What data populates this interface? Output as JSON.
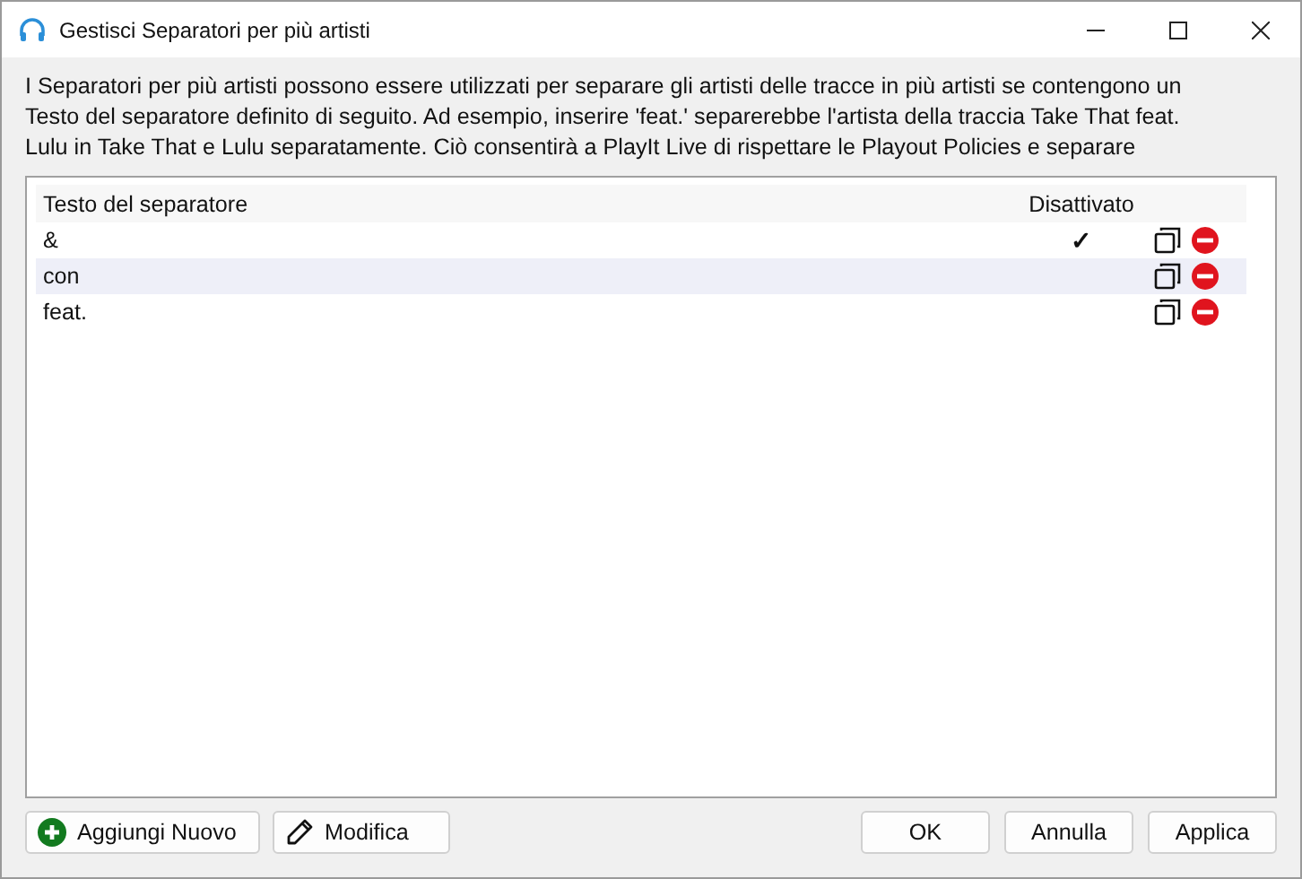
{
  "window": {
    "title": "Gestisci Separatori per più artisti"
  },
  "description": "I Separatori per più artisti possono essere utilizzati per separare gli artisti delle tracce in più artisti se contengono un\nTesto del separatore definito di seguito. Ad esempio, inserire 'feat.' separerebbe l'artista della traccia Take That feat.\nLulu in Take That e Lulu separatamente. Ciò consentirà a PlayIt Live di rispettare le Playout Policies e separare",
  "table": {
    "columns": [
      "Testo del separatore",
      "Disattivato"
    ],
    "rows": [
      {
        "text": "&",
        "disabled": true
      },
      {
        "text": "con",
        "disabled": false
      },
      {
        "text": "feat.",
        "disabled": false
      }
    ]
  },
  "check_mark": "✓",
  "left_buttons": [
    {
      "label": "Aggiungi Nuovo",
      "kind": "add"
    },
    {
      "label": "Modifica",
      "kind": "edit"
    }
  ],
  "right_buttons": [
    "OK",
    "Annulla",
    "Applica"
  ]
}
